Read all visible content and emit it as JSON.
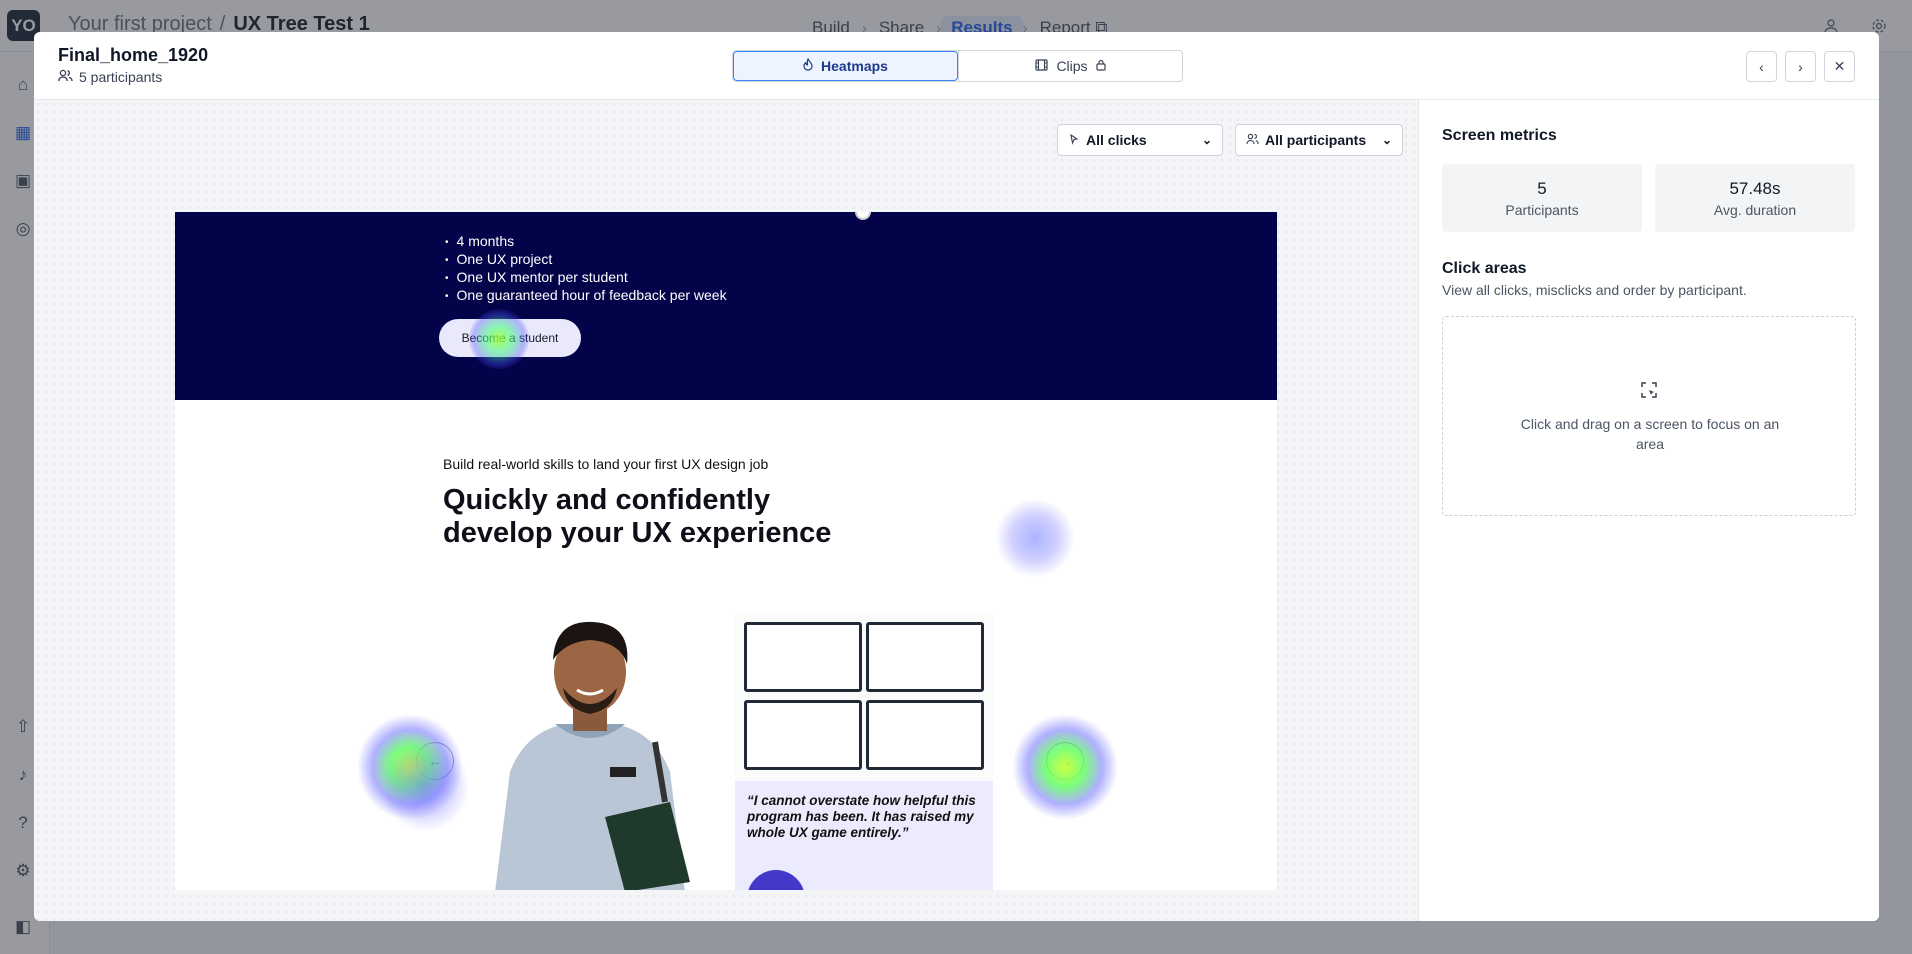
{
  "app": {
    "logo_text": "YO",
    "breadcrumb": {
      "project": "Your first project",
      "separator": "/",
      "test": "UX Tree Test 1"
    },
    "steps": [
      "Build",
      "Share",
      "Results",
      "Report"
    ],
    "active_step": "Results"
  },
  "modal": {
    "screen_title": "Final_home_1920",
    "participants_label": "5 participants",
    "tabs": {
      "heatmaps": "Heatmaps",
      "clips": "Clips"
    },
    "filters": {
      "clicks": "All clicks",
      "participants": "All participants"
    }
  },
  "preview": {
    "bullets": [
      "4 months",
      "One UX project",
      "One UX mentor per student",
      "One guaranteed hour of feedback per week"
    ],
    "cta": "Become a student",
    "kicker": "Build real-world skills to land your first UX design job",
    "headline": "Quickly and confidently develop your UX experience",
    "quote": "“I cannot overstate how helpful this program has been. It has raised my whole UX game entirely.”",
    "prev_arrow": "←",
    "next_arrow": "→"
  },
  "panel": {
    "title": "Screen metrics",
    "metrics": [
      {
        "value": "5",
        "label": "Participants"
      },
      {
        "value": "57.48s",
        "label": "Avg. duration"
      }
    ],
    "click_areas_title": "Click areas",
    "click_areas_desc": "View all clicks, misclicks and order by participant.",
    "empty_hint": "Click and drag on a screen to focus on an area"
  },
  "colors": {
    "accent": "#2563eb",
    "hero_bg": "#03034a",
    "heat_core": "#9cff3a",
    "heat_mid": "#3dff7a",
    "heat_outer": "#4b4bff"
  }
}
